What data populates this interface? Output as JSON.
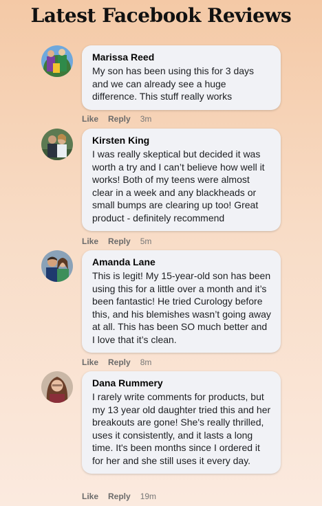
{
  "page": {
    "title": "Latest Facebook Reviews"
  },
  "reviews": [
    {
      "name": "Marissa Reed",
      "text": "My son has been using this for 3 days and we can already see a huge difference. This stuff really works",
      "like": "Like",
      "reply": "Reply",
      "time": "3m"
    },
    {
      "name": "Kirsten King",
      "text": "I was really skeptical but decided it was worth a try and I can’t believe how well it works! Both of my teens were almost clear in a week and any blackheads or small bumps are clearing up too! Great product - definitely recommend",
      "like": "Like",
      "reply": "Reply",
      "time": "5m"
    },
    {
      "name": "Amanda Lane",
      "text": "This is legit! My 15-year-old son has been using this for a little over a month and it’s been fantastic! He tried Curology before this, and his blemishes wasn’t going away at all. This has been SO much better and I love that it’s clean.",
      "like": "Like",
      "reply": "Reply",
      "time": "8m"
    },
    {
      "name": "Dana Rummery",
      "text": "I rarely write comments for products, but my 13 year old daughter tried this and her breakouts are gone! She's really thrilled, uses it consistently, and it lasts a long time. It's been months since I ordered it for her and she still uses it every day.",
      "like": "Like",
      "reply": "Reply",
      "time": "19m"
    }
  ]
}
